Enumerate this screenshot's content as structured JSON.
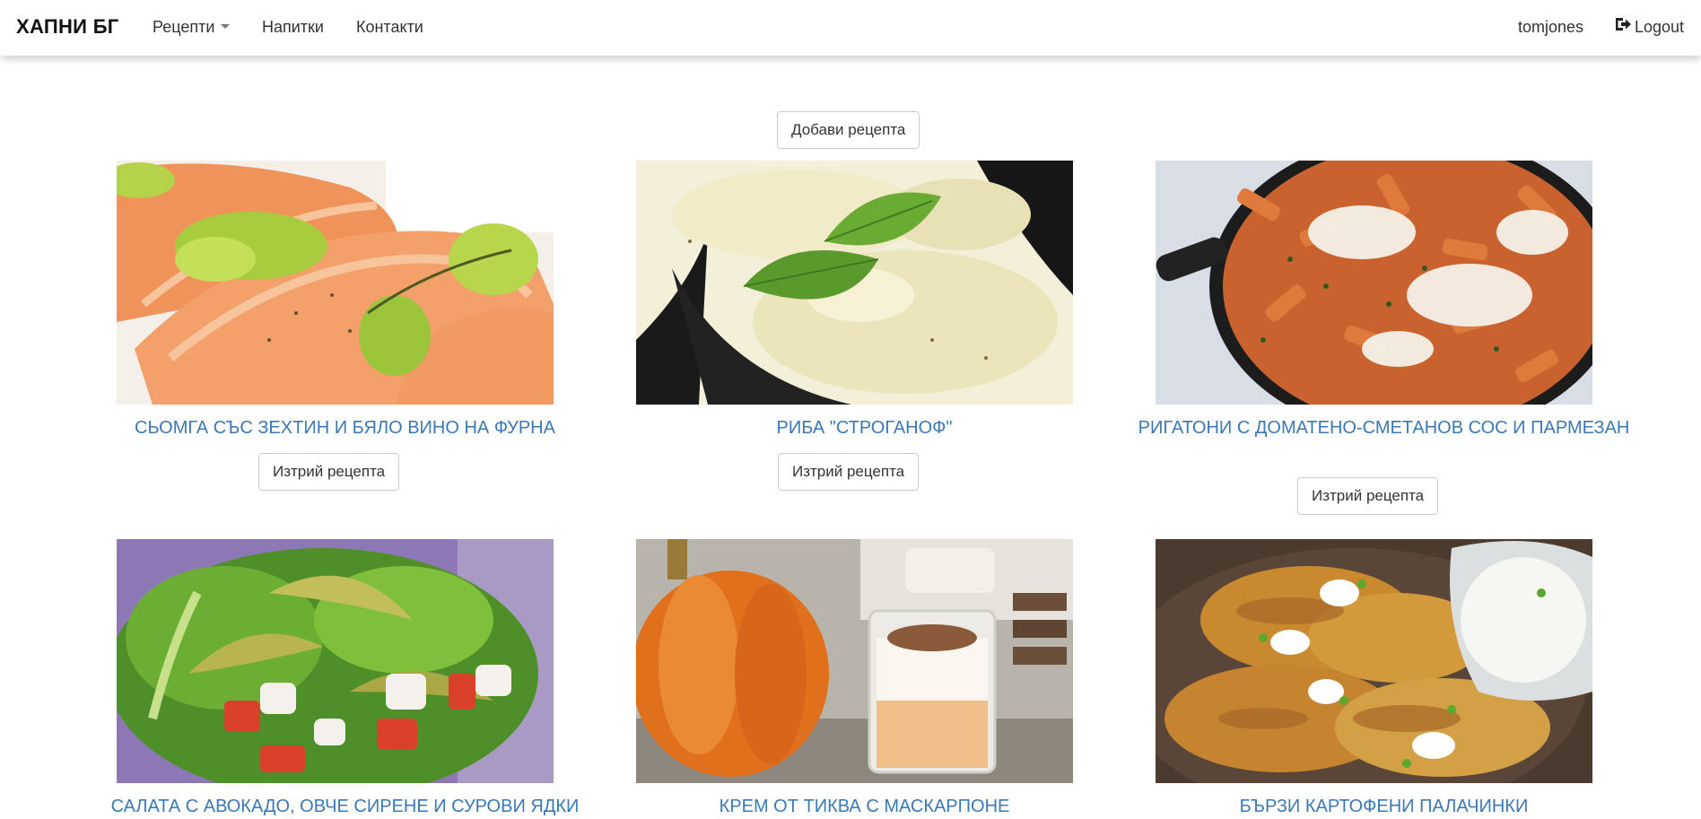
{
  "navbar": {
    "brand": "ХАПНИ БГ",
    "items": [
      {
        "label": "Рецепти",
        "has_dropdown": true
      },
      {
        "label": "Напитки"
      },
      {
        "label": "Контакти"
      }
    ],
    "username": "tomjones",
    "logout_label": "Logout"
  },
  "main": {
    "add_button_label": "Добави рецепта",
    "delete_button_label": "Изтрий рецепта",
    "recipes": [
      {
        "title": "Сьомга със зехтин и бяло вино на фурна",
        "image": "salmon-photo"
      },
      {
        "title": "Риба \"Строганоф\"",
        "image": "fish-stroganoff-photo"
      },
      {
        "title": "Ригатони с доматено-сметанов сос и пармезан",
        "image": "rigatoni-photo"
      },
      {
        "title": "Салата с авокадо, овче сирене и сурови ядки",
        "image": "avocado-salad-photo"
      },
      {
        "title": "Крем от тиква с маскарпоне",
        "image": "pumpkin-cream-photo"
      },
      {
        "title": "Бързи картофени палачинки",
        "image": "potato-pancakes-photo"
      }
    ]
  },
  "colors": {
    "title_link": "#3b78b6",
    "nav_text": "#333333",
    "brand_text": "#111111",
    "button_border": "#cccccc"
  }
}
